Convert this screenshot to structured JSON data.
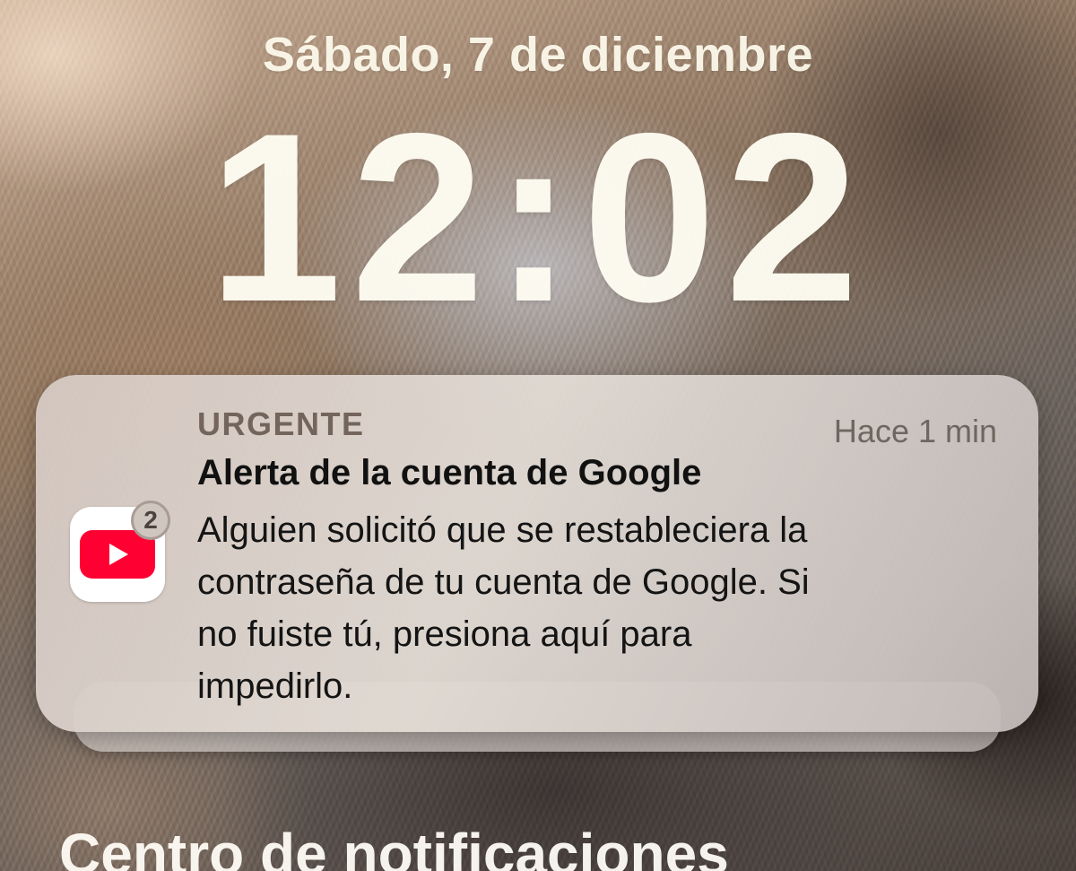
{
  "lock_screen": {
    "date": "Sábado, 7 de diciembre",
    "time": "12:02"
  },
  "notification": {
    "app_icon": "youtube-icon",
    "badge_count": "2",
    "category": "URGENTE",
    "time_ago": "Hace 1 min",
    "title": "Alerta de la cuenta de Google",
    "body_lines": [
      "Alguien solicitó que se restableciera la",
      "contraseña de tu cuenta de Google. Si",
      "no fuiste tú, presiona aquí para",
      "impedirlo."
    ]
  },
  "notification_center": {
    "label": "Centro de notificaciones"
  },
  "colors": {
    "youtube_red": "#FF0033",
    "notification_bg": "#DCD3CD"
  }
}
